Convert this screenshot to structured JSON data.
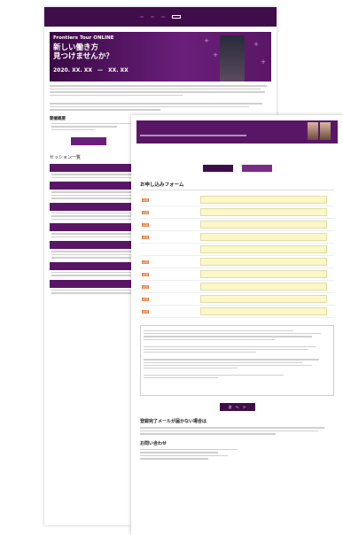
{
  "header": {
    "tag1": "",
    "tag1_text": "",
    "tag2": "",
    "tag2_text": "",
    "tag3": "",
    "tag3_text": "",
    "button": ""
  },
  "nav": [
    "",
    "",
    "",
    ""
  ],
  "hero": {
    "logo": "Frontiers Tour ONLINE",
    "headline_line1": "新しい働き方",
    "headline_line2": "見つけませんか？",
    "date": "2020. XX. XX　—　XX. XX"
  },
  "back": {
    "overview_title": "開催概要",
    "session_title": "セッション一覧",
    "session_bars": [
      "",
      "",
      "",
      "",
      "",
      "",
      "",
      ""
    ]
  },
  "front": {
    "head_line1": "",
    "head_line2": "",
    "button_left": "",
    "button_right": "",
    "form_title": "お申し込みフォーム",
    "fields": [
      {
        "label": "",
        "required": true
      },
      {
        "label": "",
        "required": true
      },
      {
        "label": "",
        "required": true
      },
      {
        "label": "",
        "required": true
      },
      {
        "label": "",
        "required": false
      },
      {
        "label": "",
        "required": true
      },
      {
        "label": "",
        "required": true
      },
      {
        "label": "",
        "required": true
      },
      {
        "label": "",
        "required": true
      },
      {
        "label": "",
        "required": true
      }
    ],
    "next_button": "次　へ　＞",
    "mail_title": "登録完了メールが届かない場合は",
    "contact_title": "お問い合わせ",
    "required_badge": "必須"
  },
  "colors": {
    "primary": "#3f0d4a",
    "accent": "#7a2b8a",
    "field": "#fbf7c6",
    "required": "#e07a3a"
  }
}
